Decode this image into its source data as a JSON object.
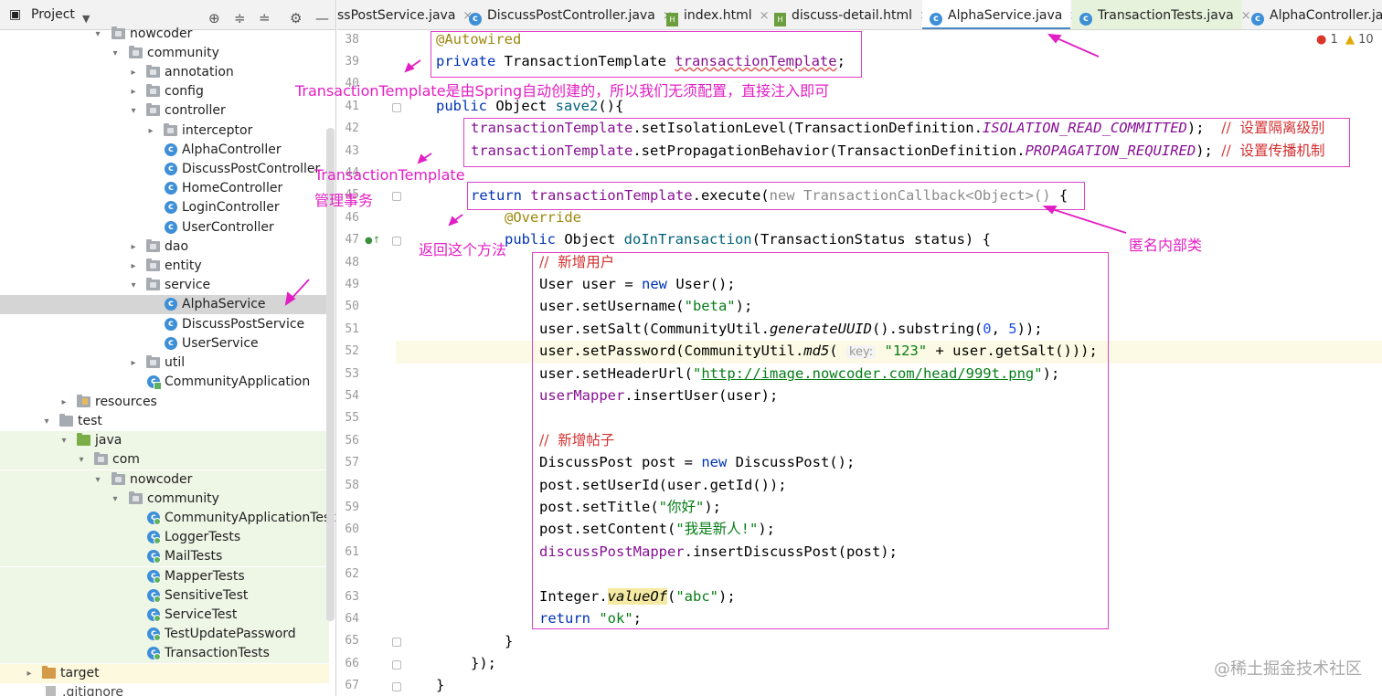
{
  "project_panel": {
    "title": "Project",
    "tree": [
      {
        "label": "nowcoder"
      },
      {
        "label": "community"
      },
      {
        "label": "annotation"
      },
      {
        "label": "config"
      },
      {
        "label": "controller"
      },
      {
        "label": "interceptor"
      },
      {
        "label": "AlphaController"
      },
      {
        "label": "DiscussPostController"
      },
      {
        "label": "HomeController"
      },
      {
        "label": "LoginController"
      },
      {
        "label": "UserController"
      },
      {
        "label": "dao"
      },
      {
        "label": "entity"
      },
      {
        "label": "service"
      },
      {
        "label": "AlphaService"
      },
      {
        "label": "DiscussPostService"
      },
      {
        "label": "UserService"
      },
      {
        "label": "util"
      },
      {
        "label": "CommunityApplication"
      },
      {
        "label": "resources"
      },
      {
        "label": "test"
      },
      {
        "label": "java"
      },
      {
        "label": "com"
      },
      {
        "label": "nowcoder"
      },
      {
        "label": "community"
      },
      {
        "label": "CommunityApplicationTests"
      },
      {
        "label": "LoggerTests"
      },
      {
        "label": "MailTests"
      },
      {
        "label": "MapperTests"
      },
      {
        "label": "SensitiveTest"
      },
      {
        "label": "ServiceTest"
      },
      {
        "label": "TestUpdatePassword"
      },
      {
        "label": "TransactionTests"
      },
      {
        "label": "target"
      },
      {
        "label": ".gitignore"
      }
    ]
  },
  "tabs": [
    {
      "label": "ssPostService.java"
    },
    {
      "label": "DiscussPostController.java"
    },
    {
      "label": "index.html"
    },
    {
      "label": "discuss-detail.html"
    },
    {
      "label": "AlphaService.java"
    },
    {
      "label": "TransactionTests.java"
    },
    {
      "label": "AlphaController.java"
    }
  ],
  "status": {
    "errors": "1",
    "warnings": "10"
  },
  "line_numbers": [
    "38",
    "39",
    "40",
    "41",
    "42",
    "43",
    "44",
    "45",
    "46",
    "47",
    "48",
    "49",
    "50",
    "51",
    "52",
    "53",
    "54",
    "55",
    "56",
    "57",
    "58",
    "59",
    "60",
    "61",
    "62",
    "63",
    "64",
    "65",
    "66",
    "67"
  ],
  "code": {
    "l38": "@Autowired",
    "l39_kw": "private",
    "l39_type": " TransactionTemplate ",
    "l39_field": "transactionTemplate",
    "l39_end": ";",
    "l41_kw": "public",
    "l41_mid": " Object ",
    "l41_name": "save2",
    "l41_end": "(){",
    "l42_field": "transactionTemplate",
    "l42_mid": ".setIsolationLevel(TransactionDefinition.",
    "l42_const": "ISOLATION_READ_COMMITTED",
    "l42_end": ");",
    "l42_cmt": "//  设置隔离级别",
    "l43_field": "transactionTemplate",
    "l43_mid": ".setPropagationBehavior(TransactionDefinition.",
    "l43_const": "PROPAGATION_REQUIRED",
    "l43_end": ");",
    "l43_cmt": "//  设置传播机制",
    "l45_kw": "return",
    "l45_field": " transactionTemplate",
    "l45_mid": ".execute(",
    "l45_gray": "new TransactionCallback<Object>()",
    "l45_end": " {",
    "l46": "@Override",
    "l47_kw": "public",
    "l47_mid": " Object ",
    "l47_name": "doInTransaction",
    "l47_end": "(TransactionStatus status) {",
    "l48": "//  新增用户",
    "l49_a": "User user = ",
    "l49_kw": "new",
    "l49_b": " User();",
    "l50_a": "user.setUsername(",
    "l50_str": "\"beta\"",
    "l50_b": ");",
    "l51_a": "user.setSalt(CommunityUtil.",
    "l51_it": "generateUUID",
    "l51_b": "().substring(",
    "l51_n1": "0",
    "l51_c": ", ",
    "l51_n2": "5",
    "l51_d": "));",
    "l52_a": "user.setPassword(CommunityUtil.",
    "l52_it": "md5",
    "l52_b": "( ",
    "l52_hint": "key:",
    "l52_str": "\"123\"",
    "l52_c": " + user.getSalt()));",
    "l53_a": "user.setHeaderUrl(",
    "l53_str1": "\"",
    "l53_url": "http://image.nowcoder.com/head/999t.png",
    "l53_str2": "\"",
    "l53_b": ");",
    "l54_fld": "userMapper",
    "l54_b": ".insertUser(user);",
    "l56": "//  新增帖子",
    "l57_a": "DiscussPost post = ",
    "l57_kw": "new",
    "l57_b": " DiscussPost();",
    "l58": "post.setUserId(user.getId());",
    "l59_a": "post.setTitle(",
    "l59_str": "\"你好\"",
    "l59_b": ");",
    "l60_a": "post.setContent(",
    "l60_str": "\"我是新人!\"",
    "l60_b": ");",
    "l61_fld": "discussPostMapper",
    "l61_b": ".insertDiscussPost(post);",
    "l63_a": "Integer.",
    "l63_it": "valueOf",
    "l63_str": "\"abc\"",
    "l63_b": ");",
    "l64_kw": "return",
    "l64_str": "\"ok\"",
    "l64_b": ";",
    "l65": "}",
    "l66": "});",
    "l67": "}"
  },
  "annotations": {
    "note1": "TransactionTemplate是由Spring自动创建的，所以我们无须配置，直接注入即可",
    "note2_line1": "TransactionTemplate",
    "note2_line2": "管理事务",
    "note3": "返回这个方法",
    "note4": "匿名内部类"
  },
  "watermark": "@稀土掘金技术社区",
  "colors": {
    "annotation_magenta": "#e21fc4",
    "keyword": "#0033b3",
    "string": "#067d17",
    "field": "#871094",
    "comment": "#d32f2f"
  }
}
